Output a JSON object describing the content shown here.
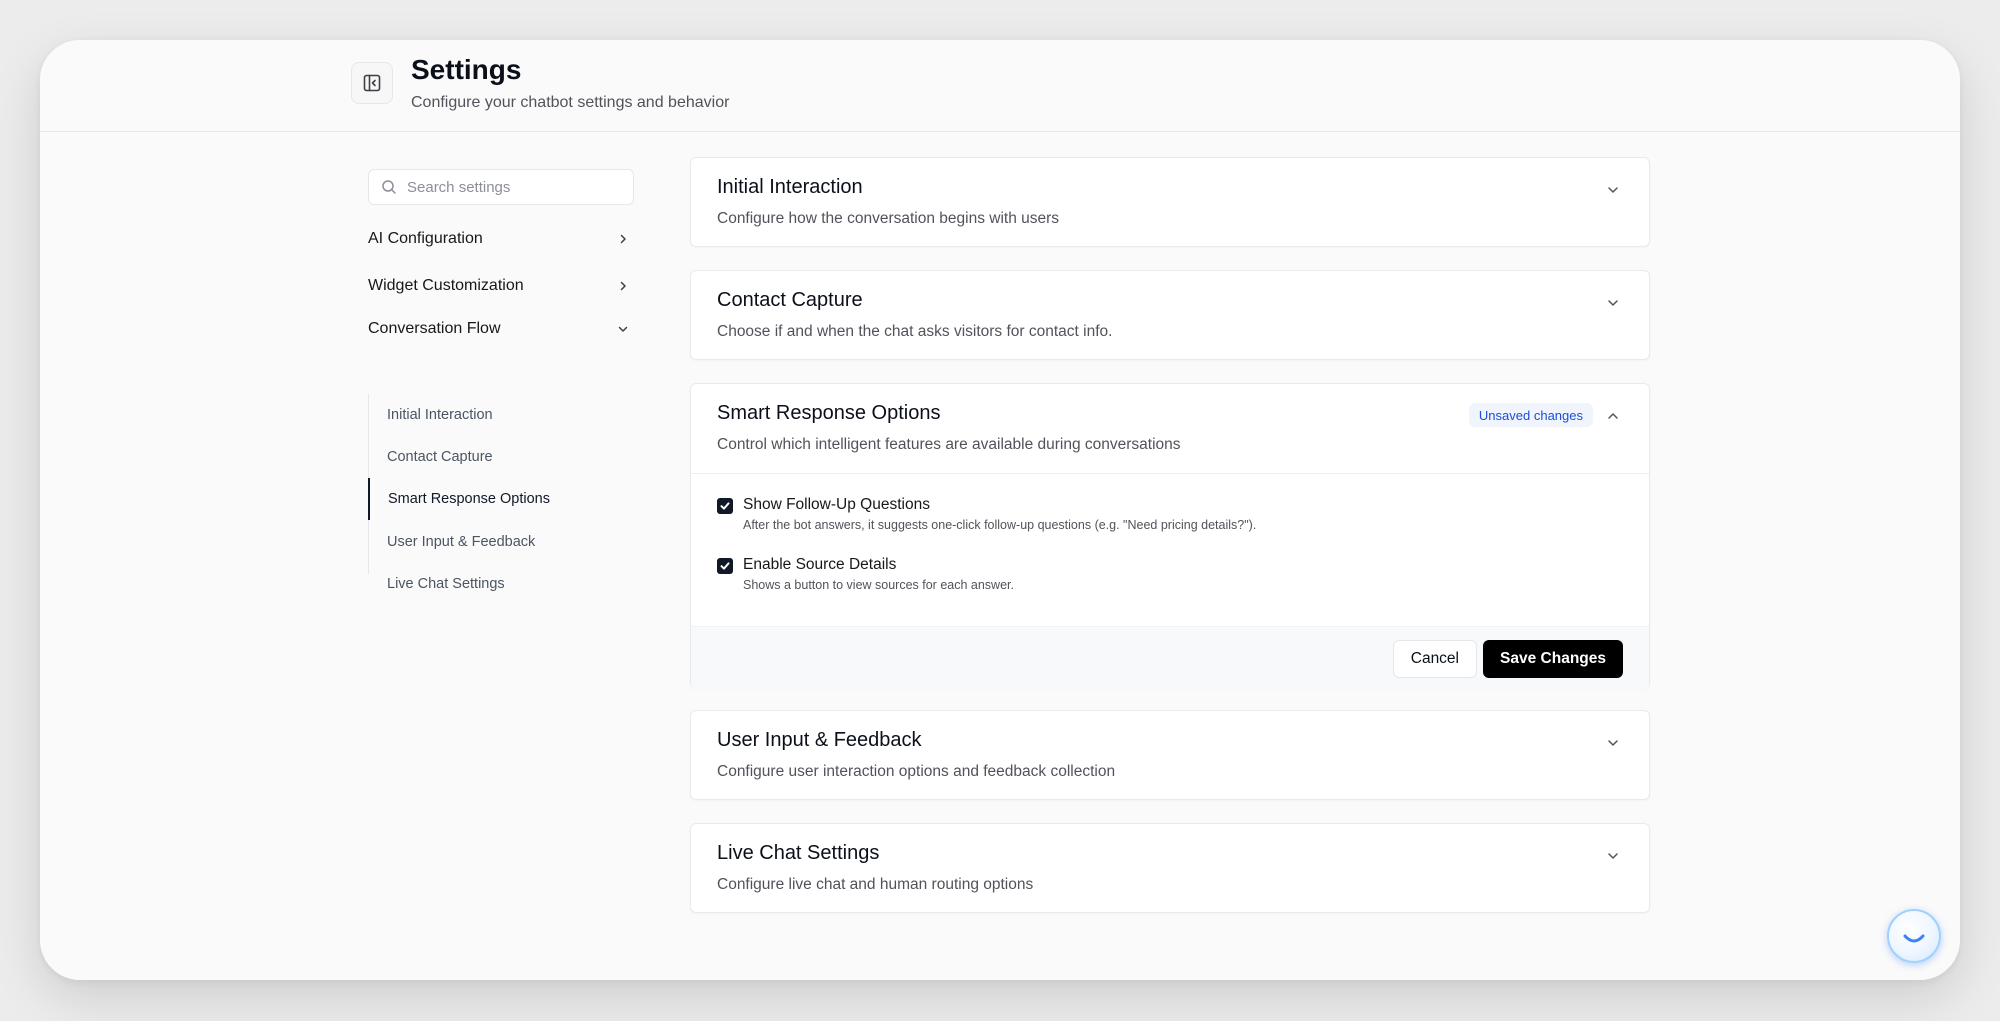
{
  "header": {
    "title": "Settings",
    "subtitle": "Configure your chatbot settings and behavior"
  },
  "sidebar": {
    "search_placeholder": "Search settings",
    "items": [
      {
        "label": "AI Configuration",
        "expanded": false
      },
      {
        "label": "Widget Customization",
        "expanded": false
      },
      {
        "label": "Conversation Flow",
        "expanded": true
      }
    ],
    "sub_items": [
      {
        "label": "Initial Interaction"
      },
      {
        "label": "Contact Capture"
      },
      {
        "label": "Smart Response Options",
        "active": true
      },
      {
        "label": "User Input & Feedback"
      },
      {
        "label": "Live Chat Settings"
      }
    ]
  },
  "sections": [
    {
      "title": "Initial Interaction",
      "description": "Configure how the conversation begins with users"
    },
    {
      "title": "Contact Capture",
      "description": "Choose if and when the chat asks visitors for contact info."
    },
    {
      "title": "Smart Response Options",
      "description": "Control which intelligent features are available during conversations",
      "badge": "Unsaved changes",
      "options": [
        {
          "label": "Show Follow-Up Questions",
          "hint": "After the bot answers, it suggests one-click follow-up questions (e.g. \"Need pricing details?\").",
          "checked": true
        },
        {
          "label": "Enable Source Details",
          "hint": "Shows a button to view sources for each answer.",
          "checked": true
        }
      ],
      "cancel_label": "Cancel",
      "save_label": "Save Changes"
    },
    {
      "title": "User Input & Feedback",
      "description": "Configure user interaction options and feedback collection"
    },
    {
      "title": "Live Chat Settings",
      "description": "Configure live chat and human routing options"
    }
  ],
  "colors": {
    "accent": "#000000",
    "badge_bg": "#eff4fd",
    "badge_text": "#1d4ed8"
  },
  "icons": [
    "sidebar-toggle-icon",
    "search-icon",
    "chevron-right-icon",
    "chevron-down-icon",
    "chevron-up-icon",
    "checkmark-icon",
    "chat-widget-icon"
  ]
}
